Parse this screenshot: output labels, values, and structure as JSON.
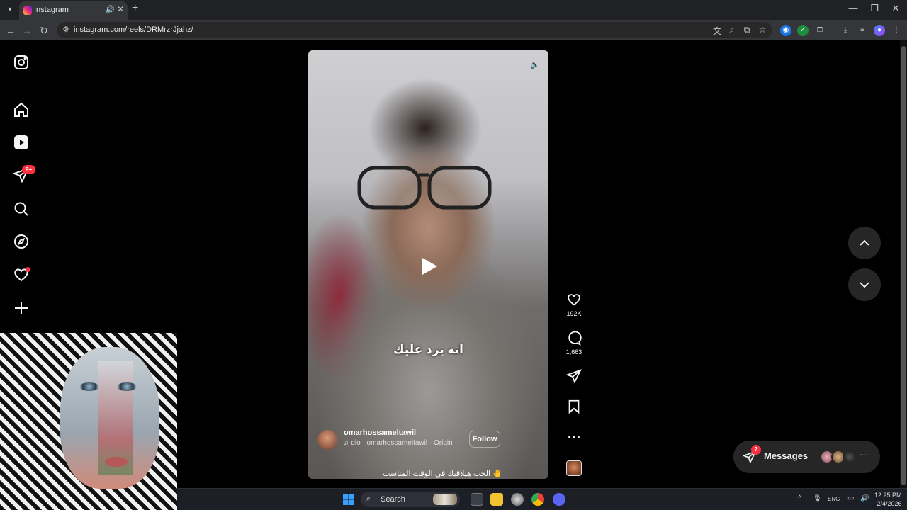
{
  "browser": {
    "tab_title": "Instagram",
    "url": "instagram.com/reels/DRMrzrJjahz/"
  },
  "sidebar": {
    "notifications_badge": "9+"
  },
  "reel": {
    "subtitle": "انه يرد عليك",
    "author": "omarhossameltawil",
    "audio": "dio · omarhossameltawil · Origin",
    "follow_label": "Follow",
    "caption": "الحب هيلاقيك في الوقت المناسب",
    "likes": "192K",
    "comments": "1,663"
  },
  "messages": {
    "label": "Messages",
    "badge": "7"
  },
  "taskbar": {
    "search_placeholder": "Search",
    "language": "ENG",
    "time": "12:25 PM",
    "date": "2/4/2026"
  },
  "colors": {
    "accent_red": "#ff3040",
    "background": "#000000",
    "pill": "#262626"
  }
}
